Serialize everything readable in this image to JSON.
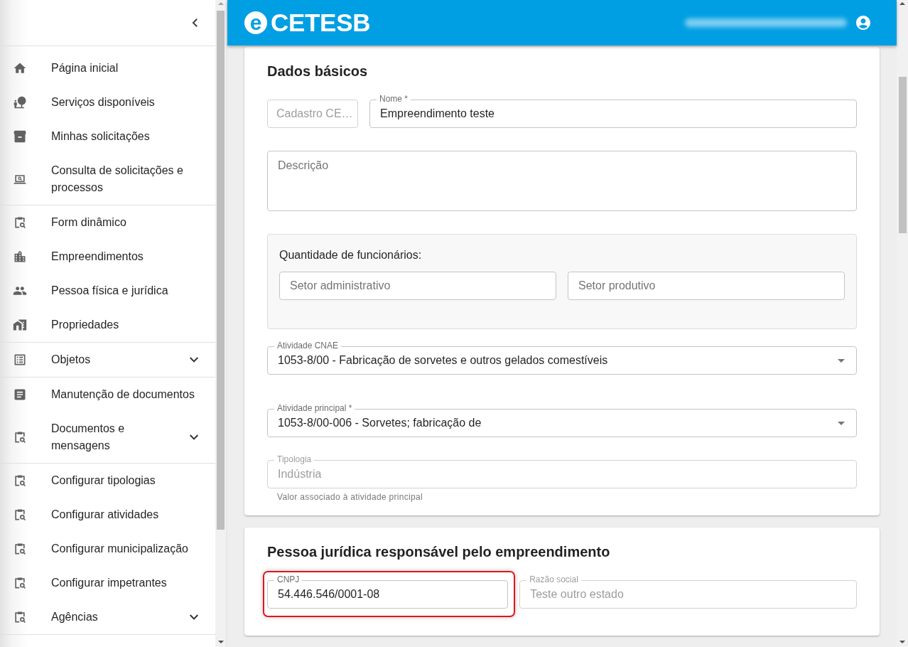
{
  "sidebar": {
    "groups": [
      {
        "items": [
          {
            "label": "Página inicial",
            "kind": "link",
            "selected": false
          },
          {
            "label": "Serviços disponíveis",
            "kind": "link",
            "selected": false
          },
          {
            "label": "Minhas solicitações",
            "kind": "link",
            "selected": false
          },
          {
            "label": "Consulta de solicitações e processos",
            "kind": "link",
            "selected": false
          }
        ]
      },
      {
        "items": [
          {
            "label": "Form dinâmico",
            "kind": "link",
            "selected": false
          },
          {
            "label": "Empreendimentos",
            "kind": "link",
            "selected": false
          },
          {
            "label": "Pessoa física e jurídica",
            "kind": "link",
            "selected": false
          },
          {
            "label": "Propriedades",
            "kind": "link",
            "selected": false
          }
        ]
      },
      {
        "items": [
          {
            "label": "Objetos",
            "kind": "group",
            "selected": false,
            "expanded": false
          }
        ]
      },
      {
        "items": [
          {
            "label": "Manutenção de documentos",
            "kind": "link",
            "selected": false
          },
          {
            "label": "Documentos e mensagens",
            "kind": "group",
            "selected": false,
            "expanded": false
          }
        ]
      },
      {
        "items": [
          {
            "label": "Configurar tipologias",
            "kind": "link",
            "selected": false
          },
          {
            "label": "Configurar atividades",
            "kind": "link",
            "selected": false
          },
          {
            "label": "Configurar municipalização",
            "kind": "link",
            "selected": false
          },
          {
            "label": "Configurar impetrantes",
            "kind": "link",
            "selected": false
          },
          {
            "label": "Agências",
            "kind": "group",
            "selected": false,
            "expanded": false
          }
        ]
      }
    ]
  },
  "header": {
    "logo": {
      "mark": "e",
      "text": "CETESB"
    }
  },
  "sections": [
    {
      "title": "Dados básicos",
      "rows": [
        {
          "kind": "prefixed",
          "fields": [
            {
              "kind": "text",
              "placeholder": "Cadastro CE…",
              "disabled": true,
              "highlighted": false
            },
            {
              "kind": "text",
              "label": "Nome *",
              "value": "Empreendimento teste",
              "disabled": false,
              "highlighted": false
            }
          ]
        },
        {
          "kind": "single",
          "fields": [
            {
              "kind": "textarea",
              "placeholder": "Descrição",
              "disabled": false,
              "highlighted": false
            }
          ]
        },
        {
          "kind": "panel",
          "title": "Quantidade de funcionários:",
          "fields": [
            {
              "kind": "text",
              "placeholder": "Setor administrativo",
              "disabled": false,
              "highlighted": false
            },
            {
              "kind": "text",
              "placeholder": "Setor produtivo",
              "disabled": false,
              "highlighted": false
            }
          ]
        },
        {
          "kind": "single",
          "fields": [
            {
              "kind": "select",
              "label": "Atividade CNAE",
              "value": "1053-8/00 - Fabricação de sorvetes e outros gelados comestíveis",
              "disabled": false,
              "highlighted": false
            }
          ]
        },
        {
          "kind": "single",
          "fields": [
            {
              "kind": "select",
              "label": "Atividade principal *",
              "value": "1053-8/00-006 - Sorvetes; fabricação de",
              "disabled": false,
              "highlighted": false
            }
          ]
        },
        {
          "kind": "single",
          "fields": [
            {
              "kind": "text",
              "label": "Tipologia",
              "value": "Indústria",
              "helper": "Valor associado à atividade principal",
              "disabled": true,
              "highlighted": false
            }
          ]
        }
      ]
    },
    {
      "title": "Pessoa jurídica responsável pelo empreendimento",
      "rows": [
        {
          "kind": "split",
          "fields": [
            {
              "kind": "text",
              "label": "CNPJ",
              "value": "54.446.546/0001-08",
              "disabled": false,
              "highlighted": true
            },
            {
              "kind": "text",
              "label": "Razão social",
              "value": "Teste outro estado",
              "disabled": true,
              "highlighted": false
            }
          ]
        }
      ]
    }
  ]
}
